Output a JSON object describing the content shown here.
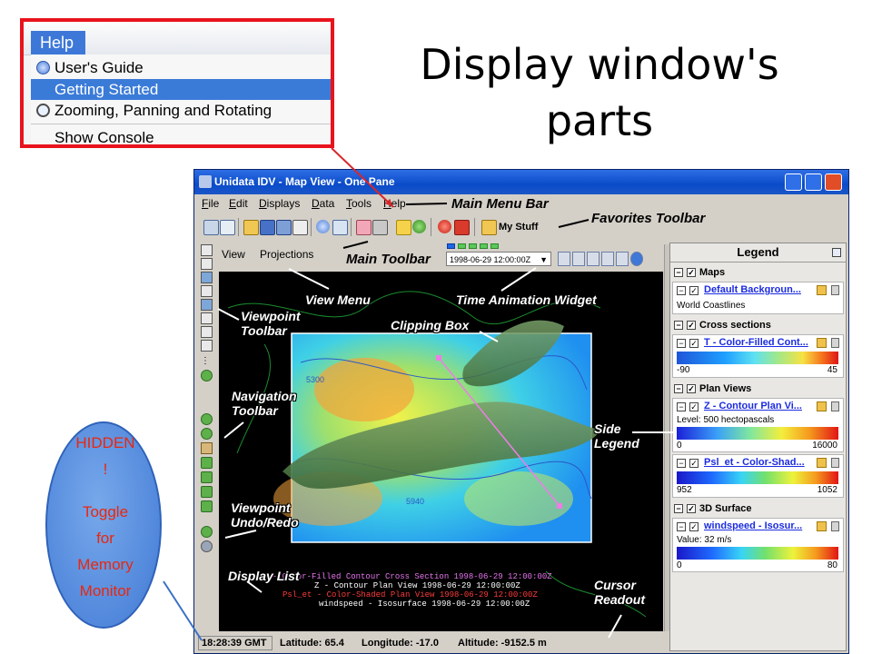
{
  "slide": {
    "title": "Display window's parts"
  },
  "help_menu": {
    "menu_label": "Help",
    "items": [
      {
        "label": "User's Guide",
        "icon": "help-circle-icon"
      },
      {
        "label": "Getting Started",
        "icon": "",
        "selected": true
      },
      {
        "label": "Zooming, Panning and Rotating",
        "icon": "magnifier-icon"
      },
      {
        "label": "Show Console",
        "icon": ""
      }
    ]
  },
  "window": {
    "title": "Unidata IDV - Map View - One Pane",
    "menus": [
      "File",
      "Edit",
      "Displays",
      "Data",
      "Tools",
      "Help"
    ],
    "favorites_label": "My Stuff",
    "view_menus": [
      "View",
      "Projections"
    ],
    "time_value": "1998-06-29 12:00:00Z",
    "display_list": [
      {
        "text": "T - Color-Filled Contour Cross Section 1998-06-29 12:00:00Z",
        "color": "#e874f0"
      },
      {
        "text": "Z - Contour Plan View 1998-06-29 12:00:00Z",
        "color": "#ffffff"
      },
      {
        "text": "Psl_et - Color-Shaded Plan View 1998-06-29 12:00:00Z",
        "color": "#ff3b3b"
      },
      {
        "text": "windspeed - Isosurface 1998-06-29 12:00:00Z",
        "color": "#ffffff"
      }
    ],
    "status": {
      "clock": "18:28:39 GMT",
      "latitude": "Latitude: 65.4",
      "longitude": "Longitude: -17.0",
      "altitude": "Altitude: -9152.5 m"
    },
    "map_contour_labels": [
      "5300",
      "5940"
    ]
  },
  "legend": {
    "title": "Legend",
    "categories": [
      {
        "name": "Maps",
        "entry": {
          "name": "Default Backgroun...",
          "subtitle": "World Coastlines"
        }
      },
      {
        "name": "Cross sections",
        "entry": {
          "name": "T - Color-Filled Cont...",
          "min": "-90",
          "max": "45"
        }
      },
      {
        "name": "Plan Views",
        "entries": [
          {
            "name": "Z - Contour Plan Vi...",
            "subtitle": "Level: 500 hectopascals",
            "min": "0",
            "max": "16000"
          },
          {
            "name": "Psl_et - Color-Shad...",
            "min": "952",
            "max": "1052"
          }
        ]
      },
      {
        "name": "3D Surface",
        "entry": {
          "name": "windspeed - Isosur...",
          "subtitle": "Value: 32 m/s",
          "min": "0",
          "max": "80"
        }
      }
    ]
  },
  "annotations": {
    "main_menu_bar": "Main Menu Bar",
    "favorites_toolbar": "Favorites Toolbar",
    "main_toolbar": "Main Toolbar",
    "view_menu": "View Menu",
    "time_animation_widget": "Time Animation Widget",
    "clipping_box": "Clipping Box",
    "viewpoint_toolbar": [
      "Viewpoint",
      "Toolbar"
    ],
    "navigation_toolbar": [
      "Navigation",
      "Toolbar"
    ],
    "side_legend": [
      "Side",
      "Legend"
    ],
    "viewpoint_undo_redo": [
      "Viewpoint",
      "Undo/Redo"
    ],
    "display_list": "Display List",
    "cursor_readout": [
      "Cursor",
      "Readout"
    ]
  },
  "memory_bubble": {
    "lines": [
      "HIDDEN",
      "!",
      "",
      "Toggle",
      "for",
      "Memory",
      "Monitor"
    ]
  },
  "colors": {
    "inset_border": "#e8131c",
    "menu_highlight": "#3b7bd8",
    "window_title": "#0a4bc9",
    "bubble": "#5288dc",
    "bubble_text": "#e9270f",
    "pointer": "#d7262b"
  }
}
